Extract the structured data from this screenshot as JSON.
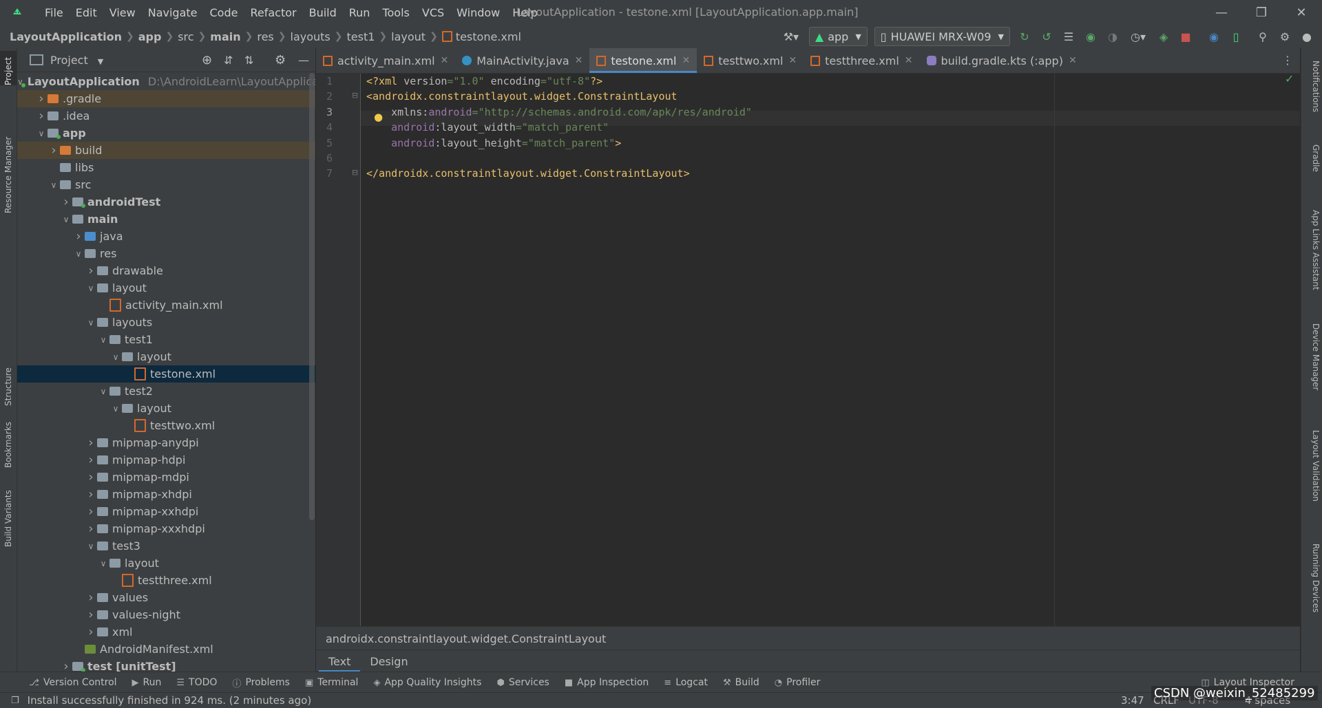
{
  "menu": [
    "File",
    "Edit",
    "View",
    "Navigate",
    "Code",
    "Refactor",
    "Build",
    "Run",
    "Tools",
    "VCS",
    "Window",
    "Help"
  ],
  "window_title": "LayoutApplication - testone.xml [LayoutApplication.app.main]",
  "breadcrumb": [
    "LayoutApplication",
    "app",
    "src",
    "main",
    "res",
    "layouts",
    "test1",
    "layout",
    "testone.xml"
  ],
  "toolbar": {
    "run_config": "app",
    "device": "HUAWEI MRX-W09"
  },
  "project_panel": {
    "title": "Project",
    "root_path": "D:\\AndroidLearn\\LayoutApplica"
  },
  "tree": [
    {
      "label": "LayoutApplication",
      "indent": 0,
      "expand": "open",
      "icon": "module-folder-icon",
      "bold": true
    },
    {
      "label": ".gradle",
      "indent": 1,
      "expand": "closed",
      "icon": "folder-icon-orange"
    },
    {
      "label": ".idea",
      "indent": 1,
      "expand": "closed",
      "icon": "folder-icon"
    },
    {
      "label": "app",
      "indent": 1,
      "expand": "open",
      "icon": "module-folder-icon",
      "bold": true
    },
    {
      "label": "build",
      "indent": 2,
      "expand": "closed",
      "icon": "folder-icon-orange"
    },
    {
      "label": "libs",
      "indent": 2,
      "expand": "none",
      "icon": "folder-icon"
    },
    {
      "label": "src",
      "indent": 2,
      "expand": "open",
      "icon": "folder-icon"
    },
    {
      "label": "androidTest",
      "indent": 3,
      "expand": "closed",
      "icon": "test-folder-icon",
      "bold": true
    },
    {
      "label": "main",
      "indent": 3,
      "expand": "open",
      "icon": "folder-icon",
      "bold": true
    },
    {
      "label": "java",
      "indent": 4,
      "expand": "closed",
      "icon": "source-folder-icon"
    },
    {
      "label": "res",
      "indent": 4,
      "expand": "open",
      "icon": "res-folder-icon"
    },
    {
      "label": "drawable",
      "indent": 5,
      "expand": "closed",
      "icon": "folder-icon"
    },
    {
      "label": "layout",
      "indent": 5,
      "expand": "open",
      "icon": "folder-icon"
    },
    {
      "label": "activity_main.xml",
      "indent": 6,
      "expand": "none",
      "icon": "xml-file-icon"
    },
    {
      "label": "layouts",
      "indent": 5,
      "expand": "open",
      "icon": "folder-icon"
    },
    {
      "label": "test1",
      "indent": 6,
      "expand": "open",
      "icon": "res-folder-icon"
    },
    {
      "label": "layout",
      "indent": 7,
      "expand": "open",
      "icon": "folder-icon"
    },
    {
      "label": "testone.xml",
      "indent": 8,
      "expand": "none",
      "icon": "xml-file-icon"
    },
    {
      "label": "test2",
      "indent": 6,
      "expand": "open",
      "icon": "res-folder-icon"
    },
    {
      "label": "layout",
      "indent": 7,
      "expand": "open",
      "icon": "folder-icon"
    },
    {
      "label": "testtwo.xml",
      "indent": 8,
      "expand": "none",
      "icon": "xml-file-icon"
    },
    {
      "label": "mipmap-anydpi",
      "indent": 5,
      "expand": "closed",
      "icon": "folder-icon"
    },
    {
      "label": "mipmap-hdpi",
      "indent": 5,
      "expand": "closed",
      "icon": "folder-icon"
    },
    {
      "label": "mipmap-mdpi",
      "indent": 5,
      "expand": "closed",
      "icon": "folder-icon"
    },
    {
      "label": "mipmap-xhdpi",
      "indent": 5,
      "expand": "closed",
      "icon": "folder-icon"
    },
    {
      "label": "mipmap-xxhdpi",
      "indent": 5,
      "expand": "closed",
      "icon": "folder-icon"
    },
    {
      "label": "mipmap-xxxhdpi",
      "indent": 5,
      "expand": "closed",
      "icon": "folder-icon"
    },
    {
      "label": "test3",
      "indent": 5,
      "expand": "open",
      "icon": "res-folder-icon"
    },
    {
      "label": "layout",
      "indent": 6,
      "expand": "open",
      "icon": "folder-icon"
    },
    {
      "label": "testthree.xml",
      "indent": 7,
      "expand": "none",
      "icon": "xml-file-icon"
    },
    {
      "label": "values",
      "indent": 5,
      "expand": "closed",
      "icon": "folder-icon"
    },
    {
      "label": "values-night",
      "indent": 5,
      "expand": "closed",
      "icon": "folder-icon"
    },
    {
      "label": "xml",
      "indent": 5,
      "expand": "closed",
      "icon": "folder-icon"
    },
    {
      "label": "AndroidManifest.xml",
      "indent": 4,
      "expand": "none",
      "icon": "manifest-file-icon"
    },
    {
      "label": "test [unitTest]",
      "indent": 3,
      "expand": "closed",
      "icon": "test-folder-icon",
      "bold": true
    }
  ],
  "selected_tree_index": 17,
  "highlighted_tree_indices": [
    1,
    4
  ],
  "tabs": [
    {
      "label": "activity_main.xml",
      "icon": "xml"
    },
    {
      "label": "MainActivity.java",
      "icon": "java"
    },
    {
      "label": "testone.xml",
      "icon": "xml",
      "active": true
    },
    {
      "label": "testtwo.xml",
      "icon": "xml"
    },
    {
      "label": "testthree.xml",
      "icon": "xml"
    },
    {
      "label": "build.gradle.kts (:app)",
      "icon": "gradle"
    }
  ],
  "code_lines": [
    [
      {
        "t": "<?xml ",
        "c": "pi"
      },
      {
        "t": "version",
        "c": "attr"
      },
      {
        "t": "=\"1.0\" ",
        "c": "str"
      },
      {
        "t": "encoding",
        "c": "attr"
      },
      {
        "t": "=\"utf-8\"",
        "c": "str"
      },
      {
        "t": "?>",
        "c": "pi"
      }
    ],
    [
      {
        "t": "<androidx.constraintlayout.widget.ConstraintLayout",
        "c": "tag"
      }
    ],
    [
      {
        "t": "    xmlns:",
        "c": "attr"
      },
      {
        "t": "android",
        "c": "ns"
      },
      {
        "t": "=\"http://schemas.android.com/apk/res/android\"",
        "c": "str"
      }
    ],
    [
      {
        "t": "    ",
        "c": "attr"
      },
      {
        "t": "android",
        "c": "ns"
      },
      {
        "t": ":layout_width",
        "c": "attr"
      },
      {
        "t": "=\"match_parent\"",
        "c": "str"
      }
    ],
    [
      {
        "t": "    ",
        "c": "attr"
      },
      {
        "t": "android",
        "c": "ns"
      },
      {
        "t": ":layout_height",
        "c": "attr"
      },
      {
        "t": "=\"match_parent\"",
        "c": "str"
      },
      {
        "t": ">",
        "c": "tag"
      }
    ],
    [],
    [
      {
        "t": "</androidx.constraintlayout.widget.ConstraintLayout>",
        "c": "tag"
      }
    ]
  ],
  "current_line": 3,
  "editor_breadcrumb": "androidx.constraintlayout.widget.ConstraintLayout",
  "editor_modes": [
    "Text",
    "Design"
  ],
  "active_mode": "Text",
  "left_strip_tabs": [
    "Project",
    "Resource Manager",
    "Structure",
    "Bookmarks",
    "Build Variants"
  ],
  "right_strip_tabs": [
    "Notifications",
    "Gradle",
    "App Links Assistant",
    "Device Manager",
    "Layout Validation",
    "Running Devices"
  ],
  "bottom_tools": [
    {
      "label": "Version Control",
      "icon": "branch-icon"
    },
    {
      "label": "Run",
      "icon": "run-icon"
    },
    {
      "label": "TODO",
      "icon": "todo-icon"
    },
    {
      "label": "Problems",
      "icon": "problems-icon"
    },
    {
      "label": "Terminal",
      "icon": "terminal-icon"
    },
    {
      "label": "App Quality Insights",
      "icon": "quality-icon"
    },
    {
      "label": "Services",
      "icon": "services-icon"
    },
    {
      "label": "App Inspection",
      "icon": "inspection-icon"
    },
    {
      "label": "Logcat",
      "icon": "logcat-icon"
    },
    {
      "label": "Build",
      "icon": "build-icon"
    },
    {
      "label": "Profiler",
      "icon": "profiler-icon"
    }
  ],
  "layout_inspector": "Layout Inspector",
  "status": {
    "message": "Install successfully finished in 924 ms. (2 minutes ago)",
    "position": "3:47",
    "line_ending": "CRLF",
    "encoding": "UTF-8",
    "indent": "4 spaces"
  },
  "watermark": "CSDN @weixin_52485299",
  "colors": {
    "accent": "#4a88c7",
    "selection": "#0d293e",
    "xml_tag": "#e8bf6a",
    "string": "#6a8759",
    "namespace": "#9876aa"
  }
}
